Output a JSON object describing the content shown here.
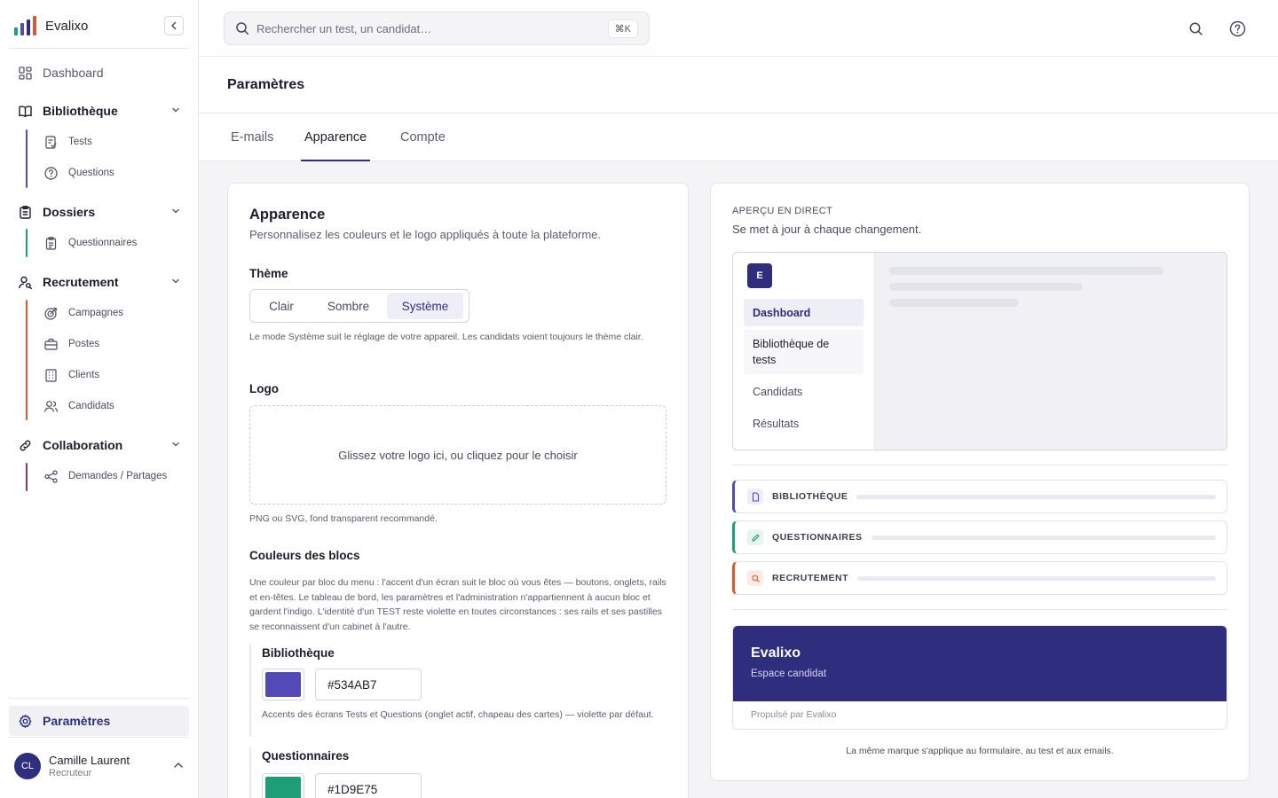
{
  "app": {
    "name": "Evalixo"
  },
  "colors": {
    "accent": "#2f2d7e",
    "bibliotheque": "#534AB7",
    "questionnaires": "#1D9E75",
    "recrutement": "#D85A30",
    "collaboration": "#8E3A5A"
  },
  "sidebar": {
    "dashboard": "Dashboard",
    "groups": [
      {
        "label": "Bibliothèque",
        "items": [
          "Tests",
          "Questions"
        ]
      },
      {
        "label": "Dossiers",
        "items": [
          "Questionnaires"
        ]
      },
      {
        "label": "Recrutement",
        "items": [
          "Campagnes",
          "Postes",
          "Clients",
          "Candidats"
        ]
      },
      {
        "label": "Collaboration",
        "items": [
          "Demandes / Partages"
        ]
      }
    ],
    "settings": "Paramètres",
    "user": {
      "initials": "CL",
      "name": "Camille Laurent",
      "role": "Recruteur"
    }
  },
  "topbar": {
    "search_placeholder": "Rechercher un test, un candidat…",
    "shortcut": "⌘K"
  },
  "page": {
    "title": "Paramètres",
    "tabs": [
      {
        "label": "E-mails"
      },
      {
        "label": "Apparence"
      },
      {
        "label": "Compte"
      }
    ]
  },
  "appearance": {
    "title": "Apparence",
    "subtitle": "Personnalisez les couleurs et le logo appliqués à toute la plateforme.",
    "theme_label": "Thème",
    "theme_options": [
      "Clair",
      "Sombre",
      "Système"
    ],
    "theme_selected": "Système",
    "theme_help": "Le mode Système suit le réglage de votre appareil. Les candidats voient toujours le thème clair.",
    "logo_label": "Logo",
    "logo_drop": "Glissez votre logo ici, ou cliquez pour le choisir",
    "logo_help": "PNG ou SVG, fond transparent recommandé.",
    "blocks_label": "Couleurs des blocs",
    "blocks_help": "Une couleur par bloc du menu : l'accent d'un écran suit le bloc où vous êtes — boutons, onglets, rails et en-têtes. Le tableau de bord, les paramètres et l'administration n'appartiennent à aucun bloc et gardent l'indigo. L'identité d'un TEST reste violette en toutes circonstances : ses rails et ses pastilles se reconnaissent d'un cabinet à l'autre.",
    "blocks": [
      {
        "name": "Bibliothèque",
        "hex": "#534AB7",
        "help": "Accents des écrans Tests et Questions (onglet actif, chapeau des cartes) — violette par défaut."
      },
      {
        "name": "Questionnaires",
        "hex": "#1D9E75"
      }
    ]
  },
  "preview": {
    "eyebrow": "APERÇU EN DIRECT",
    "subtitle": "Se met à jour à chaque changement.",
    "mock_logo": "E",
    "mock_items": [
      "Dashboard",
      "Bibliothèque de tests",
      "Candidats",
      "Résultats"
    ],
    "blocks": [
      "BIBLIOTHÈQUE",
      "QUESTIONNAIRES",
      "RECRUTEMENT"
    ],
    "candidate_title": "Evalixo",
    "candidate_sub": "Espace candidat",
    "candidate_foot": "Propulsé par Evalixo",
    "caption": "La même marque s'applique au formulaire, au test et aux emails."
  }
}
